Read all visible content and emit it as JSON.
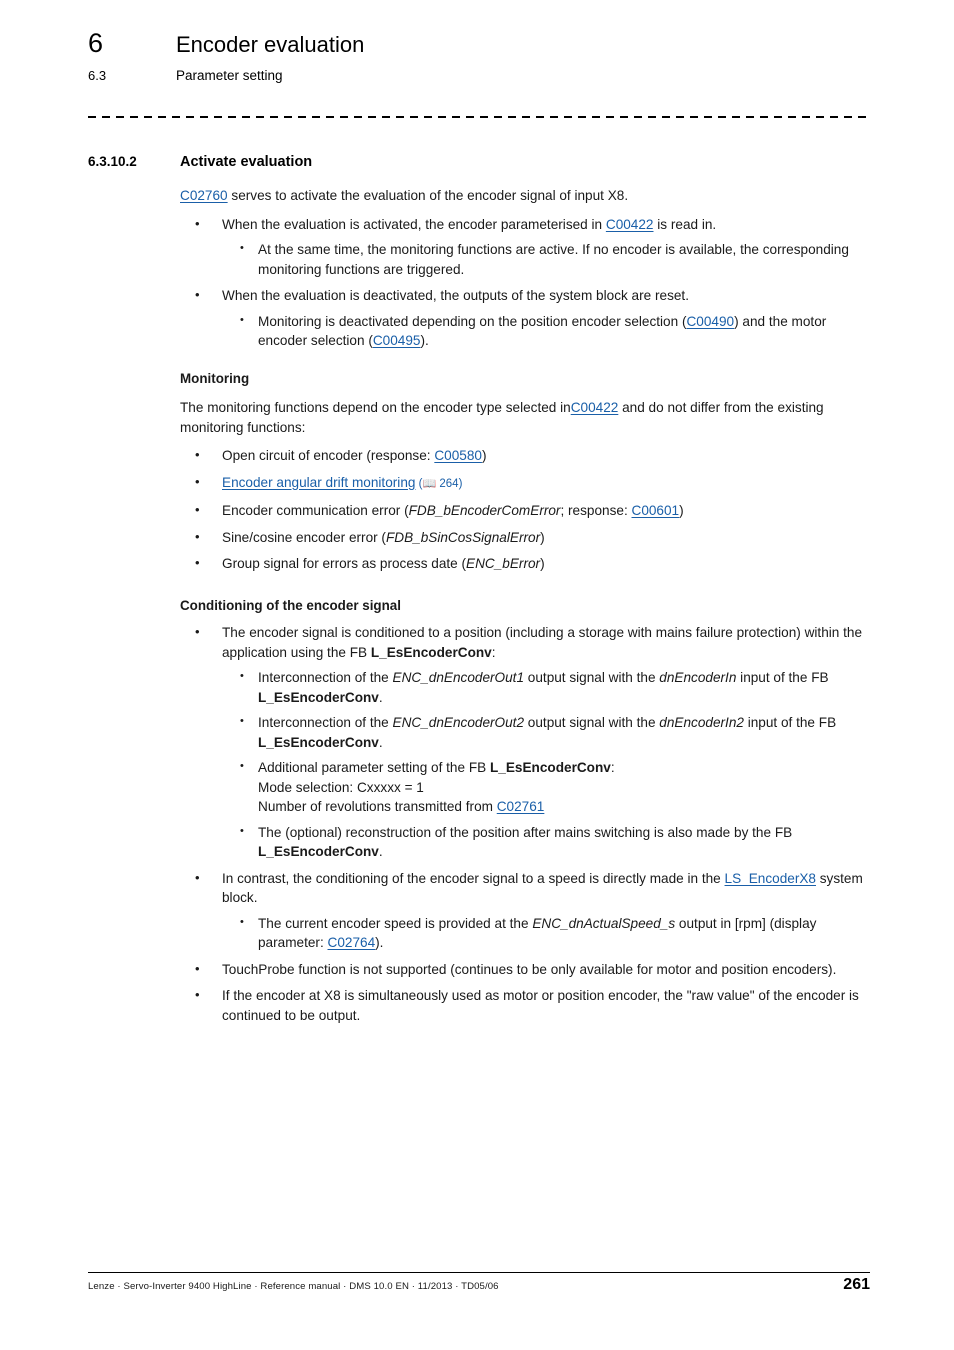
{
  "header": {
    "chapter_number": "6",
    "chapter_title": "Encoder evaluation",
    "section_number": "6.3",
    "section_title": "Parameter setting"
  },
  "section": {
    "number": "6.3.10.2",
    "title": "Activate evaluation"
  },
  "intro": {
    "link": "C02760",
    "text": " serves to activate the evaluation of the encoder signal of input X8."
  },
  "intro_bullets": {
    "b1_pre": "When the evaluation is activated, the encoder parameterised in ",
    "b1_link": "C00422",
    "b1_post": " is read in.",
    "b1_sub1": "At the same time, the monitoring functions are active. If no encoder is available, the corresponding monitoring functions are triggered.",
    "b2": "When the evaluation is deactivated, the outputs of the system block are reset.",
    "b2_sub1_pre": "Monitoring is deactivated depending on the position encoder selection (",
    "b2_sub1_link1": "C00490",
    "b2_sub1_mid": ") and the motor encoder selection (",
    "b2_sub1_link2": "C00495",
    "b2_sub1_post": ")."
  },
  "monitoring": {
    "heading": "Monitoring",
    "intro_pre": "The monitoring functions depend on the encoder type selected in",
    "intro_link": "C00422",
    "intro_post": " and do not differ from the existing monitoring functions:",
    "items": {
      "i1_pre": "Open circuit of encoder (response: ",
      "i1_link": "C00580",
      "i1_post": ")",
      "i2_link": "Encoder angular drift monitoring",
      "i2_icon": "book-icon",
      "i2_page": "264",
      "i3_pre": "Encoder communication error (",
      "i3_ital": "FDB_bEncoderComError",
      "i3_mid": "; response: ",
      "i3_link": "C00601",
      "i3_post": ")",
      "i4_pre": "Sine/cosine encoder error (",
      "i4_ital": "FDB_bSinCosSignalError",
      "i4_post": ")",
      "i5_pre": "Group signal for errors as process date (",
      "i5_ital": "ENC_bError",
      "i5_post": ")"
    }
  },
  "conditioning": {
    "heading": "Conditioning of the encoder signal",
    "b1_pre": "The encoder signal is conditioned to a position (including a storage with mains failure protection) within the application using the FB ",
    "b1_bold": "L_EsEncoderConv",
    "b1_post": ":",
    "b1_sub1_pre": "Interconnection of the ",
    "b1_sub1_ital1": "ENC_dnEncoderOut1",
    "b1_sub1_mid": " output signal with the ",
    "b1_sub1_ital2": "dnEncoderIn",
    "b1_sub1_mid2": " input of the FB ",
    "b1_sub1_bold": "L_EsEncoderConv",
    "b1_sub1_post": ".",
    "b1_sub2_pre": "Interconnection of the ",
    "b1_sub2_ital1": "ENC_dnEncoderOut2",
    "b1_sub2_mid": " output signal with the ",
    "b1_sub2_ital2": "dnEncoderIn2",
    "b1_sub2_mid2": " input of the FB ",
    "b1_sub2_bold": "L_EsEncoderConv",
    "b1_sub2_post": ".",
    "b1_sub3_pre": "Additional parameter setting of the FB ",
    "b1_sub3_bold": "L_EsEncoderConv",
    "b1_sub3_post": ":",
    "b1_sub3_line2": "Mode selection: Cxxxxx = 1",
    "b1_sub3_line3_pre": "Number of revolutions transmitted from ",
    "b1_sub3_line3_link": "C02761",
    "b1_sub4_pre": "The (optional) reconstruction of the position after mains switching is also made by the FB ",
    "b1_sub4_bold": "L_EsEncoderConv",
    "b1_sub4_post": ".",
    "b2_pre": "In contrast, the conditioning of the encoder signal to a speed  is directly made in the ",
    "b2_link": "LS_EncoderX8",
    "b2_post": " system block.",
    "b2_sub1_pre": "The current encoder speed is provided at the ",
    "b2_sub1_ital": "ENC_dnActualSpeed_s",
    "b2_sub1_mid": " output in [rpm] (display parameter: ",
    "b2_sub1_link": "C02764",
    "b2_sub1_post": ").",
    "b3": "TouchProbe function is not supported (continues to be only available for motor and position encoders).",
    "b4": "If the encoder at X8 is simultaneously used as motor or position encoder, the \"raw value\" of the encoder is continued to be output."
  },
  "footer": {
    "text": "Lenze · Servo-Inverter 9400 HighLine · Reference manual · DMS 10.0 EN · 11/2013 · TD05/06",
    "page_number": "261"
  },
  "colors": {
    "link": "#1a5fa8",
    "text": "#1a1a1a"
  }
}
